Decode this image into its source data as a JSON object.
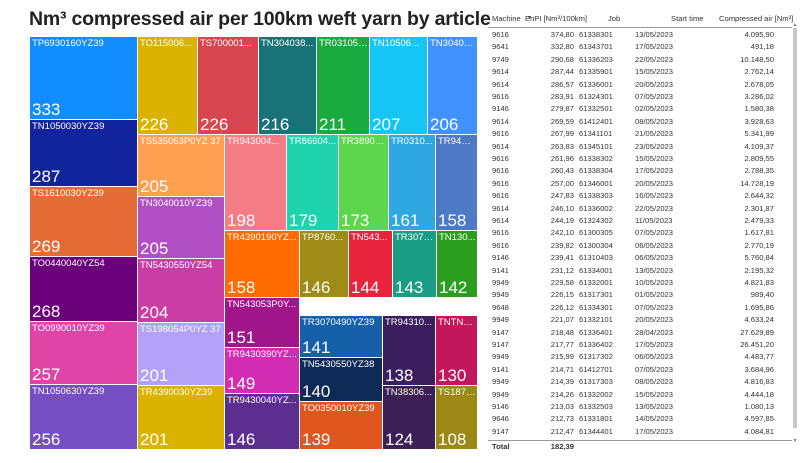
{
  "title": "Nm³ compressed air per 100km weft yarn by article",
  "chart_data": {
    "type": "treemap",
    "title": "Nm³ compressed air per 100km weft yarn by article",
    "items": [
      {
        "label": "TP6930160YZ39",
        "value": 333,
        "color": "#118DFF"
      },
      {
        "label": "TO115006...",
        "value": 226,
        "color": "#D9B300"
      },
      {
        "label": "TS700001...",
        "value": 226,
        "color": "#D64550"
      },
      {
        "label": "TN304038...",
        "value": 216,
        "color": "#197278"
      },
      {
        "label": "TR031051...",
        "value": 211,
        "color": "#1AAB40"
      },
      {
        "label": "TN10506...",
        "value": 207,
        "color": "#15C6F4"
      },
      {
        "label": "TN30403...",
        "value": 206,
        "color": "#4092FF"
      },
      {
        "label": "TN1050030YZ39",
        "value": 287,
        "color": "#12239E"
      },
      {
        "label": "TS1610030YZ39",
        "value": 269,
        "color": "#E66C37"
      },
      {
        "label": "TO0440040YZ54",
        "value": 268,
        "color": "#6B007B"
      },
      {
        "label": "TO0990010YZ39",
        "value": 257,
        "color": "#E044A7"
      },
      {
        "label": "TN1050630YZ39",
        "value": 256,
        "color": "#744EC2"
      },
      {
        "label": "TS535063P0YZ 37",
        "value": 205,
        "color": "#FF9F52"
      },
      {
        "label": "TN3040010YZ39",
        "value": 205,
        "color": "#B14FC5"
      },
      {
        "label": "TN5430550YZ54",
        "value": 204,
        "color": "#C93DA4"
      },
      {
        "label": "TS198054P0YZ 37",
        "value": 201,
        "color": "#B3A1F8"
      },
      {
        "label": "TR4390030YZ39",
        "value": 201,
        "color": "#D9B300"
      },
      {
        "label": "TR943004...",
        "value": 198,
        "color": "#F47C85"
      },
      {
        "label": "TR86604...",
        "value": 179,
        "color": "#1FD3AE"
      },
      {
        "label": "TR38905...",
        "value": 173,
        "color": "#5DD54C"
      },
      {
        "label": "TR0310...",
        "value": 161,
        "color": "#2FA8E2"
      },
      {
        "label": "TR9431...",
        "value": 158,
        "color": "#4E79C4"
      },
      {
        "label": "TR4390190YZ...",
        "value": 158,
        "color": "#FF6B00"
      },
      {
        "label": "TP8760...",
        "value": 146,
        "color": "#9E8B17"
      },
      {
        "label": "TN543...",
        "value": 144,
        "color": "#E8243C"
      },
      {
        "label": "TR3070...",
        "value": 143,
        "color": "#1B9C85"
      },
      {
        "label": "TN130...",
        "value": 142,
        "color": "#2C9E1F"
      },
      {
        "label": "TN543053P0Y...",
        "value": 151,
        "color": "#A0158A"
      },
      {
        "label": "TR9430390YZ...",
        "value": 149,
        "color": "#D22CB3"
      },
      {
        "label": "TR9430040YZ...",
        "value": 146,
        "color": "#5B2E8F"
      },
      {
        "label": "TR3070490YZ39",
        "value": 141,
        "color": "#1560A8"
      },
      {
        "label": "TR94310...",
        "value": 138,
        "color": "#3B1E5E"
      },
      {
        "label": "TNTN8...",
        "value": 130,
        "color": "#C2185B"
      },
      {
        "label": "TN5430550YZ38",
        "value": 140,
        "color": "#0E2A56"
      },
      {
        "label": "TO0350010YZ39",
        "value": 139,
        "color": "#E0561F"
      },
      {
        "label": "TN38306...",
        "value": 124,
        "color": "#3C1F54"
      },
      {
        "label": "TS1870...",
        "value": 108,
        "color": "#9D8816"
      }
    ]
  },
  "table": {
    "headers": {
      "machine": "Machine",
      "enpi": "EnPI [Nm³/100km]",
      "job": "Job",
      "start": "Start time",
      "air": "Compressed air [Nm³]"
    },
    "sort_icon": "sort-descending-icon",
    "rows": [
      [
        "9616",
        "374,80",
        "61338301",
        "13/05/2023",
        "4.095,90"
      ],
      [
        "9641",
        "332,80",
        "61343701",
        "17/05/2023",
        "491,18"
      ],
      [
        "9749",
        "290,68",
        "61336203",
        "22/05/2023",
        "10.148,50"
      ],
      [
        "9614",
        "287,44",
        "61335901",
        "15/05/2023",
        "2.762,14"
      ],
      [
        "9614",
        "286,57",
        "61336001",
        "20/05/2023",
        "2.678,05"
      ],
      [
        "9616",
        "283,91",
        "61324301",
        "07/05/2023",
        "3.286,02"
      ],
      [
        "9146",
        "279,87",
        "61332501",
        "02/05/2023",
        "1.580,38"
      ],
      [
        "9614",
        "269,59",
        "61412401",
        "08/05/2023",
        "3.928,63"
      ],
      [
        "9616",
        "267,99",
        "61341101",
        "21/05/2023",
        "5.341,99"
      ],
      [
        "9614",
        "263,83",
        "61345101",
        "23/05/2023",
        "4.109,37"
      ],
      [
        "9616",
        "261,96",
        "61338302",
        "15/05/2023",
        "2.809,55"
      ],
      [
        "9616",
        "260,43",
        "61338304",
        "17/05/2023",
        "2.788,35"
      ],
      [
        "9616",
        "257,00",
        "61346001",
        "20/05/2023",
        "14.728,19"
      ],
      [
        "9616",
        "247,83",
        "61338303",
        "16/05/2023",
        "2.644,32"
      ],
      [
        "9614",
        "246,10",
        "61336002",
        "22/05/2023",
        "2.301,87"
      ],
      [
        "9614",
        "244,19",
        "61324302",
        "11/05/2023",
        "2.479,33"
      ],
      [
        "9616",
        "242,10",
        "61300305",
        "07/05/2023",
        "1.617,81"
      ],
      [
        "9616",
        "239,82",
        "61300304",
        "06/05/2023",
        "2.770,19"
      ],
      [
        "9146",
        "239,41",
        "61310403",
        "06/05/2023",
        "5.760,84"
      ],
      [
        "9141",
        "231,12",
        "61334001",
        "13/05/2023",
        "2.195,32"
      ],
      [
        "9949",
        "229,58",
        "61332001",
        "10/05/2023",
        "4.821,83"
      ],
      [
        "9949",
        "226,15",
        "61317301",
        "01/05/2023",
        "989,40"
      ],
      [
        "9648",
        "226,12",
        "61334301",
        "07/05/2023",
        "1.695,86"
      ],
      [
        "9949",
        "221,07",
        "61332101",
        "20/05/2023",
        "4.633,24"
      ],
      [
        "9147",
        "218,48",
        "61336401",
        "28/04/2023",
        "27.629,89"
      ],
      [
        "9147",
        "217,77",
        "61336402",
        "17/05/2023",
        "26.451,20"
      ],
      [
        "9949",
        "215,99",
        "61317302",
        "06/05/2023",
        "4.483,77"
      ],
      [
        "9141",
        "214,71",
        "61412701",
        "07/05/2023",
        "3.684,96"
      ],
      [
        "9949",
        "214,39",
        "61317303",
        "08/05/2023",
        "4.816,83"
      ],
      [
        "9949",
        "214,26",
        "61332002",
        "15/05/2023",
        "4.444,18"
      ],
      [
        "9146",
        "213,03",
        "61332503",
        "13/05/2023",
        "1.080,13"
      ],
      [
        "9646",
        "212,73",
        "61331801",
        "14/05/2023",
        "4.597,85"
      ],
      [
        "9147",
        "212,47",
        "61344401",
        "17/05/2023",
        "4.084,81"
      ]
    ],
    "total": {
      "label": "Total",
      "value": "182,39"
    }
  }
}
